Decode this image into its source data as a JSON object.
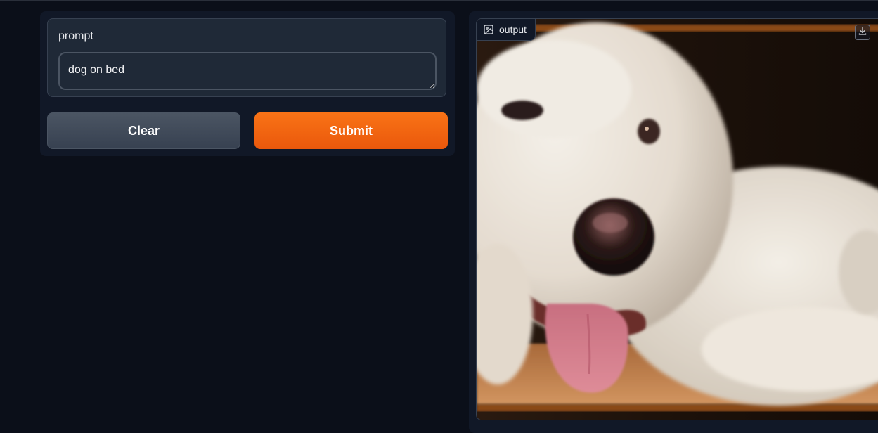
{
  "input": {
    "label": "prompt",
    "value": "dog on bed"
  },
  "buttons": {
    "clear_label": "Clear",
    "submit_label": "Submit"
  },
  "output": {
    "label": "output",
    "image_description": "dog on bed",
    "icons": {
      "label_icon": "image-icon",
      "download_icon": "download-icon"
    }
  },
  "colors": {
    "background": "#0b0f19",
    "panel": "#111827",
    "block": "#1f2937",
    "submit": "#f97316",
    "clear": "#4b5563"
  }
}
